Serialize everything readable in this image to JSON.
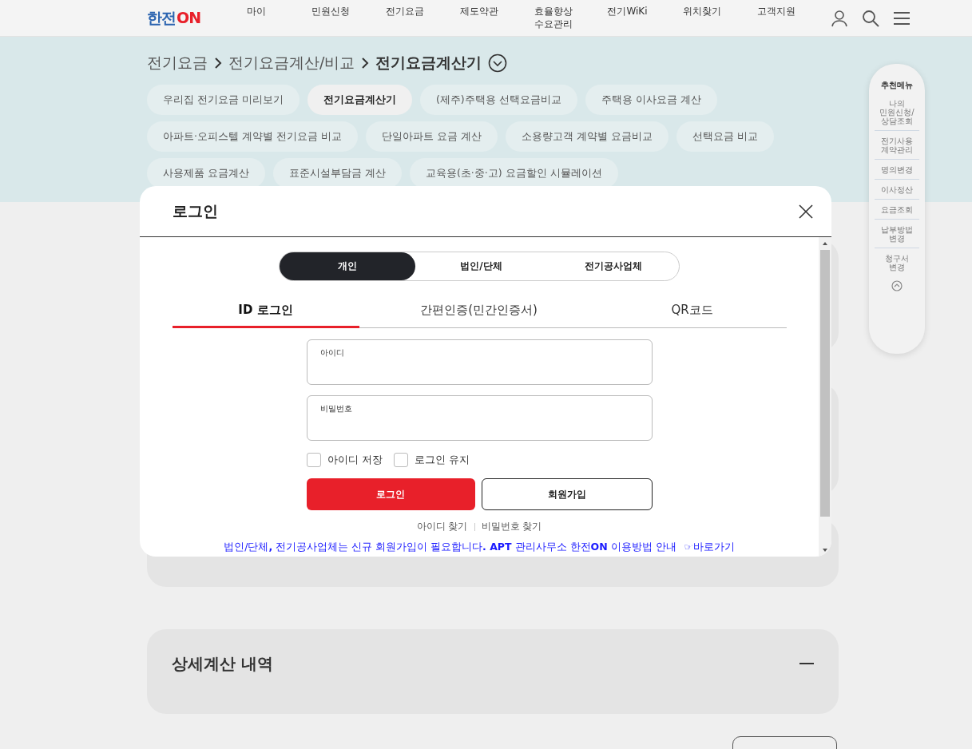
{
  "header": {
    "logo": {
      "text": "한전",
      "mark": "ON"
    },
    "nav": [
      "마이",
      "민원신청",
      "전기요금",
      "제도약관",
      "효율향상\n수요관리",
      "전기WiKi",
      "위치찾기",
      "고객지원"
    ]
  },
  "breadcrumb": {
    "items": [
      "전기요금",
      "전기요금계산/비교",
      "전기요금계산기"
    ]
  },
  "chips": [
    {
      "label": "우리집 전기요금 미리보기",
      "selected": false
    },
    {
      "label": "전기요금계산기",
      "selected": true
    },
    {
      "label": "(제주)주택용 선택요금비교",
      "selected": false
    },
    {
      "label": "주택용 이사요금 계산",
      "selected": false
    },
    {
      "label": "아파트·오피스텔 계약별 전기요금 비교",
      "selected": false
    },
    {
      "label": "단일아파트 요금 계산",
      "selected": false
    },
    {
      "label": "소용량고객 계약별 요금비교",
      "selected": false
    },
    {
      "label": "선택요금 비교",
      "selected": false
    },
    {
      "label": "사용제품 요금계산",
      "selected": false
    },
    {
      "label": "표준시설부담금 계산",
      "selected": false
    },
    {
      "label": "교육용(초·중·고) 요금할인 시뮬레이션",
      "selected": false
    }
  ],
  "sections": [
    {
      "title": "상세계산 내역",
      "expanded": true
    }
  ],
  "side_menu": {
    "title": "추천메뉴",
    "items": [
      "나의\n민원신청/\n상담조회",
      "전기사용\n계약관리",
      "명의변경",
      "이사정산",
      "요금조회",
      "납부방법\n변경",
      "청구서\n변경"
    ]
  },
  "modal": {
    "title": "로그인",
    "segments": [
      {
        "label": "개인",
        "selected": true
      },
      {
        "label": "법인/단체",
        "selected": false
      },
      {
        "label": "전기공사업체",
        "selected": false
      }
    ],
    "tabs": [
      {
        "label": "ID 로그인",
        "selected": true
      },
      {
        "label": "간편인증(민간인증서)",
        "selected": false
      },
      {
        "label": "QR코드",
        "selected": false
      }
    ],
    "fields": [
      {
        "label": "아이디"
      },
      {
        "label": "비밀번호"
      }
    ],
    "checkboxes": [
      {
        "label": "아이디 저장",
        "checked": false
      },
      {
        "label": "로그인 유지",
        "checked": false
      }
    ],
    "login_button": "로그인",
    "signup_button": "회원가입",
    "links": [
      "아이디 찾기",
      "비밀번호 찾기"
    ],
    "notice": "법인/단체**,** 전기공사업체는 신규 회원가입이 필요합니다**. APT** 관리사무소 한전**ON** 이용방법 안내",
    "notice_link": "☞바로가기"
  }
}
